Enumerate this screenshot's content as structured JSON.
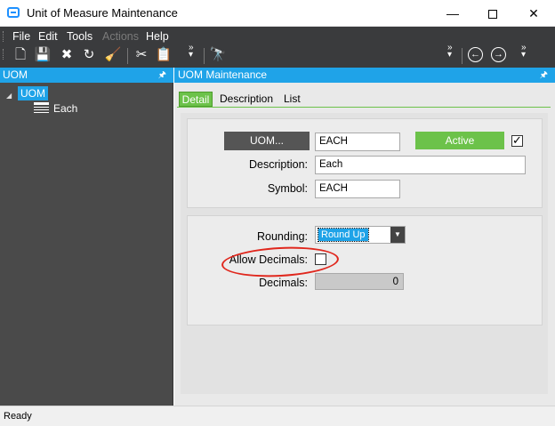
{
  "window": {
    "title": "Unit of Measure Maintenance",
    "minimize": "—",
    "close": "✕"
  },
  "menu": {
    "file": "File",
    "edit": "Edit",
    "tools": "Tools",
    "actions": "Actions",
    "help": "Help"
  },
  "toolbar": {
    "new": "🗋",
    "save": "💾",
    "delete": "✖",
    "refresh": "↻",
    "clear": "🧹",
    "cut": "✂",
    "paste": "📋",
    "binoculars": "🔭",
    "more": "»",
    "back": "←",
    "forward": "→"
  },
  "left_panel": {
    "title": "UOM",
    "pin": "🖈",
    "tree": {
      "root": "UOM",
      "children": [
        "Each"
      ]
    }
  },
  "main_panel": {
    "title": "UOM Maintenance",
    "pin": "🖈",
    "tabs": [
      "Detail",
      "Description",
      "List"
    ],
    "active_tab": "Detail",
    "uom_button": "UOM...",
    "uom_value": "EACH",
    "active_label": "Active",
    "active_checked": true,
    "description_label": "Description:",
    "description_value": "Each",
    "symbol_label": "Symbol:",
    "symbol_value": "EACH",
    "rounding_label": "Rounding:",
    "rounding_value": "Round Up",
    "allow_decimals_label": "Allow Decimals:",
    "allow_decimals_checked": false,
    "decimals_label": "Decimals:",
    "decimals_value": "0"
  },
  "status": {
    "text": "Ready"
  },
  "colors": {
    "accent_blue": "#1fa3e8",
    "active_green": "#6cc24a",
    "annotation_red": "#e0271d"
  }
}
